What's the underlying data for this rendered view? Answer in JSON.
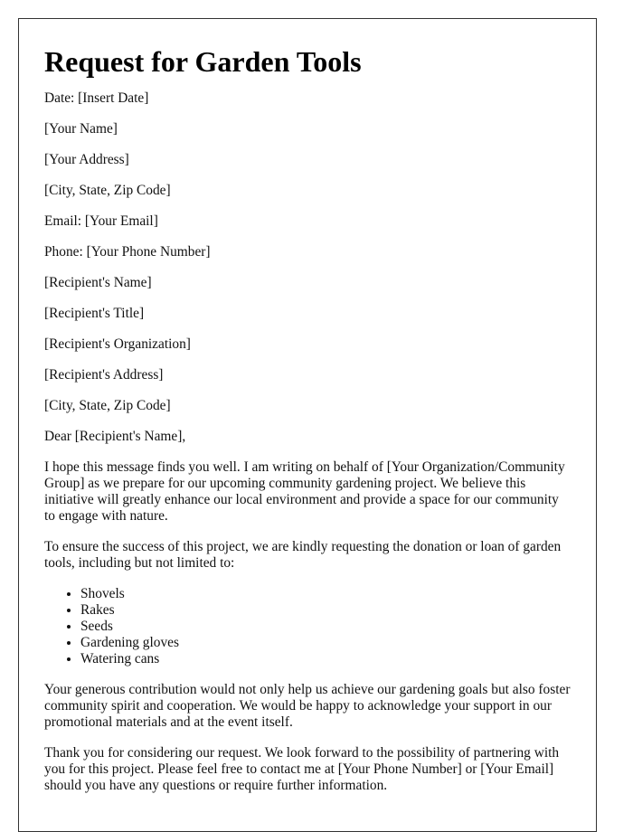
{
  "letter": {
    "title": "Request for Garden Tools",
    "sender": {
      "date": "Date: [Insert Date]",
      "name": "[Your Name]",
      "address": "[Your Address]",
      "city_state_zip": "[City, State, Zip Code]",
      "email": "Email: [Your Email]",
      "phone": "Phone: [Your Phone Number]"
    },
    "recipient": {
      "name": "[Recipient's Name]",
      "title": "[Recipient's Title]",
      "organization": "[Recipient's Organization]",
      "address": "[Recipient's Address]",
      "city_state_zip": "[City, State, Zip Code]"
    },
    "salutation": "Dear [Recipient's Name],",
    "paragraphs": [
      "I hope this message finds you well. I am writing on behalf of [Your Organization/Community Group] as we prepare for our upcoming community gardening project. We believe this initiative will greatly enhance our local environment and provide a space for our community to engage with nature.",
      "To ensure the success of this project, we are kindly requesting the donation or loan of garden tools, including but not limited to:",
      "Your generous contribution would not only help us achieve our gardening goals but also foster community spirit and cooperation. We would be happy to acknowledge your support in our promotional materials and at the event itself.",
      "Thank you for considering our request. We look forward to the possibility of partnering with you for this project. Please feel free to contact me at [Your Phone Number] or [Your Email] should you have any questions or require further information."
    ],
    "tools": [
      "Shovels",
      "Rakes",
      "Seeds",
      "Gardening gloves",
      "Watering cans"
    ]
  }
}
